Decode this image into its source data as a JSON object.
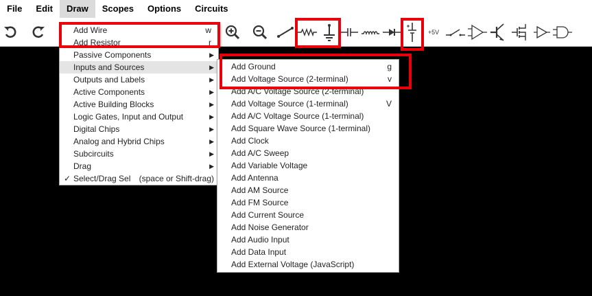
{
  "menubar": {
    "items": [
      {
        "label": "File"
      },
      {
        "label": "Edit"
      },
      {
        "label": "Draw"
      },
      {
        "label": "Scopes"
      },
      {
        "label": "Options"
      },
      {
        "label": "Circuits"
      }
    ],
    "active_index": 2
  },
  "toolbar": {
    "tools": [
      {
        "icon": "undo-icon"
      },
      {
        "icon": "redo-icon"
      },
      {
        "icon": "zoom-in-icon"
      },
      {
        "icon": "zoom-out-icon"
      },
      {
        "icon": "wire-icon"
      },
      {
        "icon": "resistor-icon"
      },
      {
        "icon": "ground-icon"
      },
      {
        "icon": "capacitor-icon"
      },
      {
        "icon": "inductor-icon"
      },
      {
        "icon": "diode-icon"
      },
      {
        "icon": "voltage-source-icon"
      },
      {
        "icon": "rail-icon",
        "label": "+5V"
      },
      {
        "icon": "switch-icon"
      },
      {
        "icon": "op-amp-icon"
      },
      {
        "icon": "transistor-icon"
      },
      {
        "icon": "mosfet-icon"
      },
      {
        "icon": "buffer-icon"
      },
      {
        "icon": "and-gate-icon"
      }
    ]
  },
  "draw_menu": {
    "items": [
      {
        "label": "Add Wire",
        "shortcut": "w"
      },
      {
        "label": "Add Resistor",
        "shortcut": "r"
      },
      {
        "label": "Passive Components",
        "submenu": true
      },
      {
        "label": "Inputs and Sources",
        "submenu": true
      },
      {
        "label": "Outputs and Labels",
        "submenu": true
      },
      {
        "label": "Active Components",
        "submenu": true
      },
      {
        "label": "Active Building Blocks",
        "submenu": true
      },
      {
        "label": "Logic Gates, Input and Output",
        "submenu": true
      },
      {
        "label": "Digital Chips",
        "submenu": true
      },
      {
        "label": "Analog and Hybrid Chips",
        "submenu": true
      },
      {
        "label": "Subcircuits",
        "submenu": true
      },
      {
        "label": "Drag",
        "submenu": true
      },
      {
        "label": "Select/Drag Sel",
        "shortcut": "(space or Shift-drag)",
        "checked": true
      }
    ],
    "highlighted": "Inputs and Sources"
  },
  "sources_menu": {
    "items": [
      {
        "label": "Add Ground",
        "shortcut": "g"
      },
      {
        "label": "Add Voltage Source (2-terminal)",
        "shortcut": "v"
      },
      {
        "label": "Add A/C Voltage Source (2-terminal)",
        "shortcut": ""
      },
      {
        "label": "Add Voltage Source (1-terminal)",
        "shortcut": "V"
      },
      {
        "label": "Add A/C Voltage Source (1-terminal)",
        "shortcut": ""
      },
      {
        "label": "Add Square Wave Source (1-terminal)",
        "shortcut": ""
      },
      {
        "label": "Add Clock",
        "shortcut": ""
      },
      {
        "label": "Add A/C Sweep",
        "shortcut": ""
      },
      {
        "label": "Add Variable Voltage",
        "shortcut": ""
      },
      {
        "label": "Add Antenna",
        "shortcut": ""
      },
      {
        "label": "Add AM Source",
        "shortcut": ""
      },
      {
        "label": "Add FM Source",
        "shortcut": ""
      },
      {
        "label": "Add Current Source",
        "shortcut": ""
      },
      {
        "label": "Add Noise Generator",
        "shortcut": ""
      },
      {
        "label": "Add Audio Input",
        "shortcut": ""
      },
      {
        "label": "Add Data Input",
        "shortcut": ""
      },
      {
        "label": "Add External Voltage (JavaScript)",
        "shortcut": ""
      }
    ]
  },
  "colors": {
    "highlight_box": "#e8000b",
    "canvas": "#000000",
    "menu_hover": "#e4e4e4"
  }
}
